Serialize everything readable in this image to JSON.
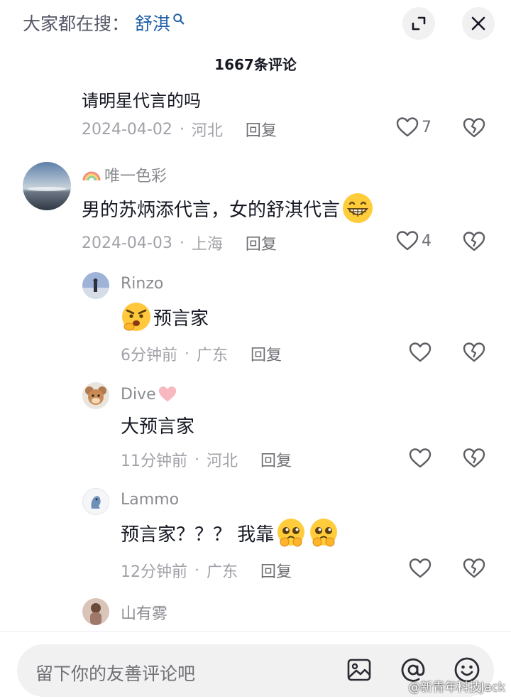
{
  "header": {
    "search_prefix": "大家都在搜：",
    "search_keyword": "舒淇",
    "comment_count": "1667条评论"
  },
  "comments": [
    {
      "partial_text": "请明星代言的吗",
      "date": "2024-04-02",
      "location": "河北",
      "reply_label": "回复",
      "likes": "7"
    },
    {
      "username": "唯一色彩",
      "text": "男的苏炳添代言，女的舒淇代言",
      "date": "2024-04-03",
      "location": "上海",
      "reply_label": "回复",
      "likes": "4"
    }
  ],
  "replies": [
    {
      "username": "Rinzo",
      "text": "预言家",
      "time": "6分钟前",
      "location": "广东",
      "reply_label": "回复"
    },
    {
      "username": "Dive",
      "text": "大预言家",
      "time": "11分钟前",
      "location": "河北",
      "reply_label": "回复"
    },
    {
      "username": "Lammo",
      "text": "预言家？？？ 我靠",
      "time": "12分钟前",
      "location": "广东",
      "reply_label": "回复"
    },
    {
      "username": "山有雾"
    }
  ],
  "footer": {
    "input_placeholder": "留下你的友善评论吧",
    "watermark": "@新青年科技Jack"
  },
  "icons": [
    "search-icon",
    "expand-icon",
    "close-icon",
    "heart-icon",
    "broken-heart-icon",
    "image-icon",
    "at-icon",
    "emoji-icon"
  ],
  "colors": {
    "keyword": "#1f5fa8",
    "meta": "#a1a2a8",
    "text": "#161823",
    "pill": "#f1f1f2"
  }
}
